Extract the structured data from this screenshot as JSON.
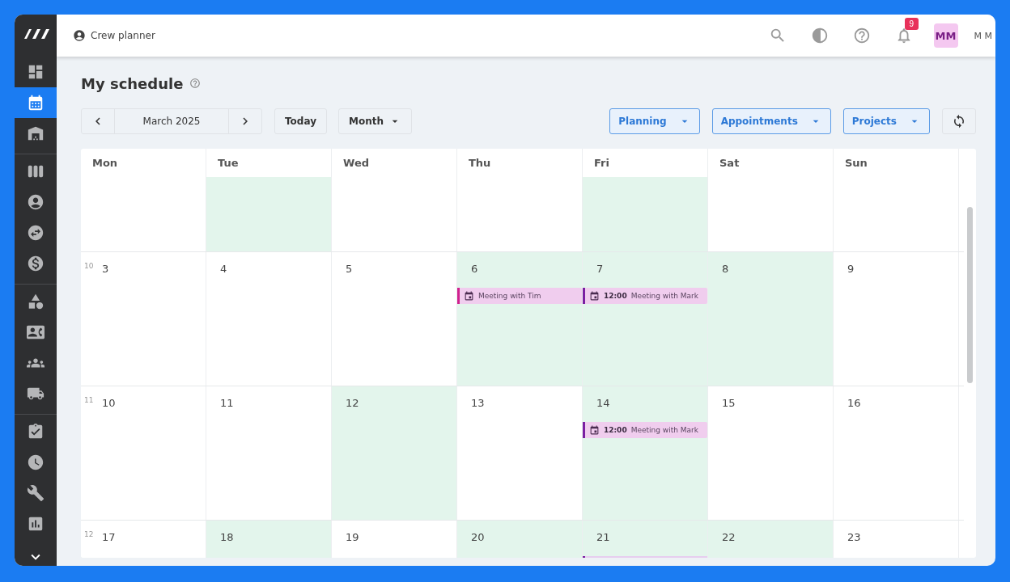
{
  "app": {
    "name": "Crew planner"
  },
  "sidebar": {
    "groups": [
      [
        {
          "kind": "dashboard",
          "selected": false
        },
        {
          "kind": "calendar",
          "selected": true
        },
        {
          "kind": "warehouse",
          "selected": false
        }
      ],
      [
        {
          "kind": "table",
          "selected": false
        },
        {
          "kind": "person",
          "selected": false
        },
        {
          "kind": "swap",
          "selected": false
        },
        {
          "kind": "dollar",
          "selected": false
        }
      ],
      [
        {
          "kind": "shapes",
          "selected": false
        },
        {
          "kind": "contact",
          "selected": false
        },
        {
          "kind": "group",
          "selected": false
        },
        {
          "kind": "truck",
          "selected": false
        }
      ],
      [
        {
          "kind": "clipboard",
          "selected": false
        },
        {
          "kind": "clock",
          "selected": false
        },
        {
          "kind": "wrench",
          "selected": false
        },
        {
          "kind": "chart",
          "selected": false
        }
      ]
    ]
  },
  "topbar": {
    "notifications": "9",
    "avatar": "MM",
    "user": "M M"
  },
  "page": {
    "title": "My schedule"
  },
  "toolbar": {
    "month": "March 2025",
    "today": "Today",
    "view": "Month",
    "filters": [
      "Planning",
      "Appointments",
      "Projects"
    ]
  },
  "calendar": {
    "days": [
      "Mon",
      "Tue",
      "Wed",
      "Thu",
      "Fri",
      "Sat",
      "Sun"
    ],
    "weeks": [
      {
        "kind": "partial",
        "cells": [
          {
            "highlighted": false
          },
          {
            "highlighted": true
          },
          {
            "highlighted": false
          },
          {
            "highlighted": false
          },
          {
            "highlighted": true
          },
          {
            "highlighted": false
          },
          {
            "highlighted": false
          }
        ]
      },
      {
        "kind": "full",
        "week": "10",
        "cells": [
          {
            "date": "3",
            "highlighted": false
          },
          {
            "date": "4",
            "highlighted": false
          },
          {
            "date": "5",
            "highlighted": false
          },
          {
            "date": "6",
            "highlighted": true,
            "events": [
              {
                "kind": "allday",
                "title": "Meeting with Tim",
                "color": "#d0218f"
              }
            ]
          },
          {
            "date": "7",
            "highlighted": true,
            "events": [
              {
                "kind": "timed",
                "time": "12:00",
                "title": "Meeting with Mark",
                "color": "#7b1fa2"
              }
            ]
          },
          {
            "date": "8",
            "highlighted": true
          },
          {
            "date": "9",
            "highlighted": false
          }
        ]
      },
      {
        "kind": "full",
        "week": "11",
        "cells": [
          {
            "date": "10",
            "highlighted": false
          },
          {
            "date": "11",
            "highlighted": false
          },
          {
            "date": "12",
            "highlighted": true
          },
          {
            "date": "13",
            "highlighted": false
          },
          {
            "date": "14",
            "highlighted": true,
            "events": [
              {
                "kind": "timed",
                "time": "12:00",
                "title": "Meeting with Mark",
                "color": "#7b1fa2"
              }
            ]
          },
          {
            "date": "15",
            "highlighted": false
          },
          {
            "date": "16",
            "highlighted": false
          }
        ]
      },
      {
        "kind": "full",
        "week": "12",
        "cells": [
          {
            "date": "17",
            "highlighted": false
          },
          {
            "date": "18",
            "highlighted": true
          },
          {
            "date": "19",
            "highlighted": false
          },
          {
            "date": "20",
            "highlighted": true
          },
          {
            "date": "21",
            "highlighted": true,
            "events": [
              {
                "kind": "strip",
                "color": "#7b1fa2"
              }
            ]
          },
          {
            "date": "22",
            "highlighted": true
          },
          {
            "date": "23",
            "highlighted": false
          }
        ]
      }
    ]
  }
}
